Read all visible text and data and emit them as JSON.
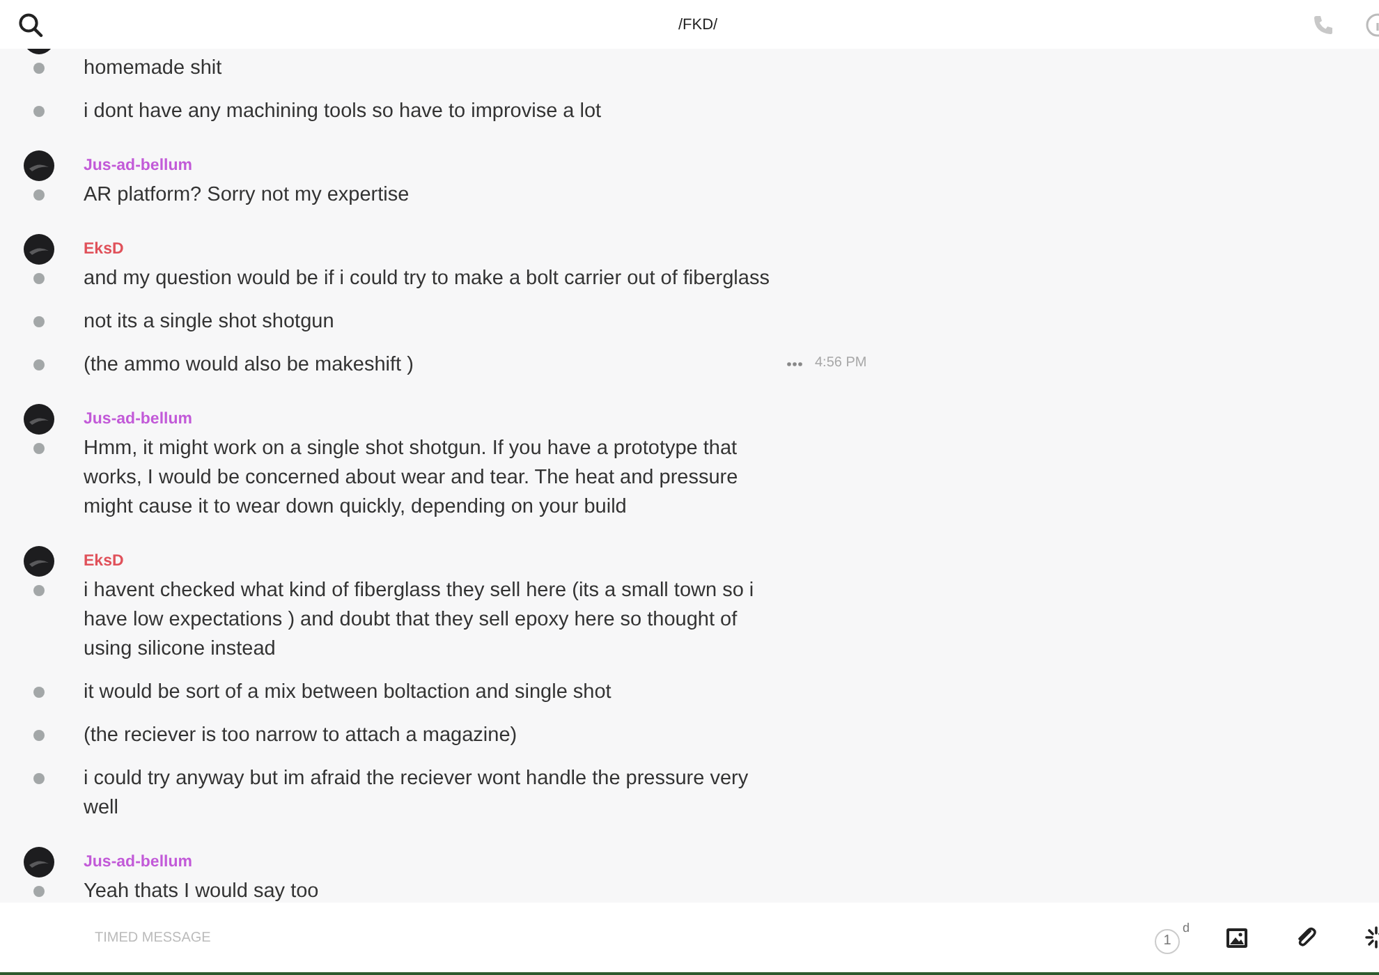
{
  "header": {
    "title": "/FKD/"
  },
  "groups": [
    {
      "messages": [
        {
          "text": "homemade shit"
        },
        {
          "text": "i dont have any machining tools so have to improvise a lot"
        }
      ]
    },
    {
      "author": "Jus-ad-bellum",
      "color": "#c25ad8",
      "messages": [
        {
          "text": "AR platform? Sorry not my expertise"
        }
      ]
    },
    {
      "author": "EksD",
      "color": "#e0515a",
      "messages": [
        {
          "text": "and my question would be if i could try to make a bolt carrier out of fiberglass"
        },
        {
          "text": "not its a single shot shotgun"
        },
        {
          "text": "(the ammo would also be makeshift )",
          "time": "4:56 PM"
        }
      ]
    },
    {
      "author": "Jus-ad-bellum",
      "color": "#c25ad8",
      "messages": [
        {
          "text": "Hmm, it might work on a single shot shotgun. If you have a prototype that works, I would be concerned about wear and tear. The heat and pressure might cause it to wear down quickly, depending on your build"
        }
      ]
    },
    {
      "author": "EksD",
      "color": "#e0515a",
      "messages": [
        {
          "text": "i havent checked what kind of fiberglass they sell here (its a small town so i have low expectations ) and doubt that they sell epoxy here so thought of using silicone instead"
        },
        {
          "text": "it would be sort of a mix between boltaction and single shot"
        },
        {
          "text": "(the reciever is too narrow to attach a magazine)"
        },
        {
          "text": "i could try anyway but im afraid the reciever wont handle the pressure very well"
        }
      ]
    },
    {
      "author": "Jus-ad-bellum",
      "color": "#c25ad8",
      "messages": [
        {
          "text": "Yeah thats I would say too"
        }
      ]
    }
  ],
  "composer": {
    "placeholder": "TIMED MESSAGE",
    "timer": "1",
    "timer_unit": "d"
  }
}
